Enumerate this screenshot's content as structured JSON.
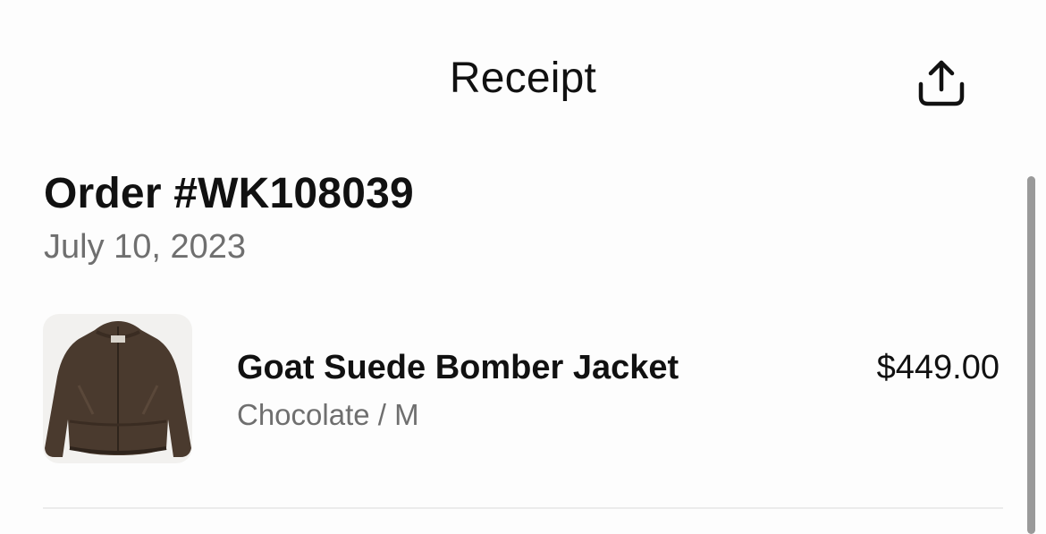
{
  "header": {
    "title": "Receipt",
    "share_icon": "share-upload-icon"
  },
  "order": {
    "number": "Order #WK108039",
    "date": "July 10, 2023"
  },
  "items": [
    {
      "thumbnail_icon": "jacket-thumbnail",
      "name": "Goat Suede Bomber Jacket",
      "variant": "Chocolate / M",
      "price": "$449.00"
    }
  ],
  "colors": {
    "background": "#fdfdfd",
    "text_primary": "#111111",
    "text_secondary": "#6f6f6f",
    "thumbnail_bg": "#f2f1ef",
    "jacket": "#4a3a2e"
  }
}
